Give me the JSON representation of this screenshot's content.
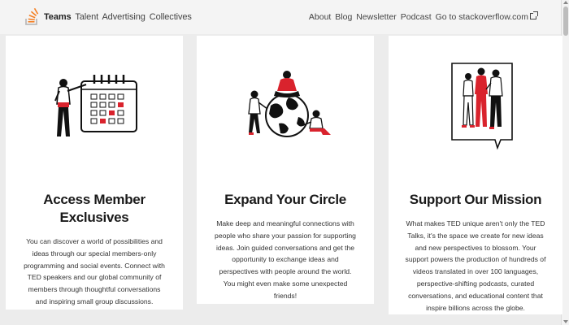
{
  "nav": {
    "left": [
      "Teams",
      "Talent",
      "Advertising",
      "Collectives"
    ],
    "right": [
      "About",
      "Blog",
      "Newsletter",
      "Podcast",
      "Go to stackoverflow.com"
    ]
  },
  "cards": [
    {
      "title_line1": "Access Member",
      "title_line2": "Exclusives",
      "body_lines": [
        "You can discover a world of possibilities and",
        "ideas through our special members-only",
        "programming and social events. Connect with",
        "TED speakers and our global community of",
        "members through thoughtful conversations",
        "and inspiring small group discussions."
      ]
    },
    {
      "title": "Expand Your Circle",
      "body_lines": [
        "Make deep and meaningful connections with",
        "people who share your passion for supporting",
        "ideas. Join guided conversations and get the",
        "opportunity to exchange ideas and",
        "perspectives with people around the world.",
        "You might even make some unexpected",
        "friends!"
      ]
    },
    {
      "title": "Support Our Mission",
      "body_lines": [
        "What makes TED unique aren't only the TED",
        "Talks, it's the space we create for new ideas",
        "and new perspectives to blossom. Your",
        "support powers the production of hundreds of",
        "videos translated in over 100 languages,",
        "perspective-shifting podcasts, curated",
        "conversations, and educational content that",
        "inspire billions across the globe."
      ]
    }
  ],
  "colors": {
    "accent": "#d9232d",
    "brand_logo": "#f48024"
  }
}
